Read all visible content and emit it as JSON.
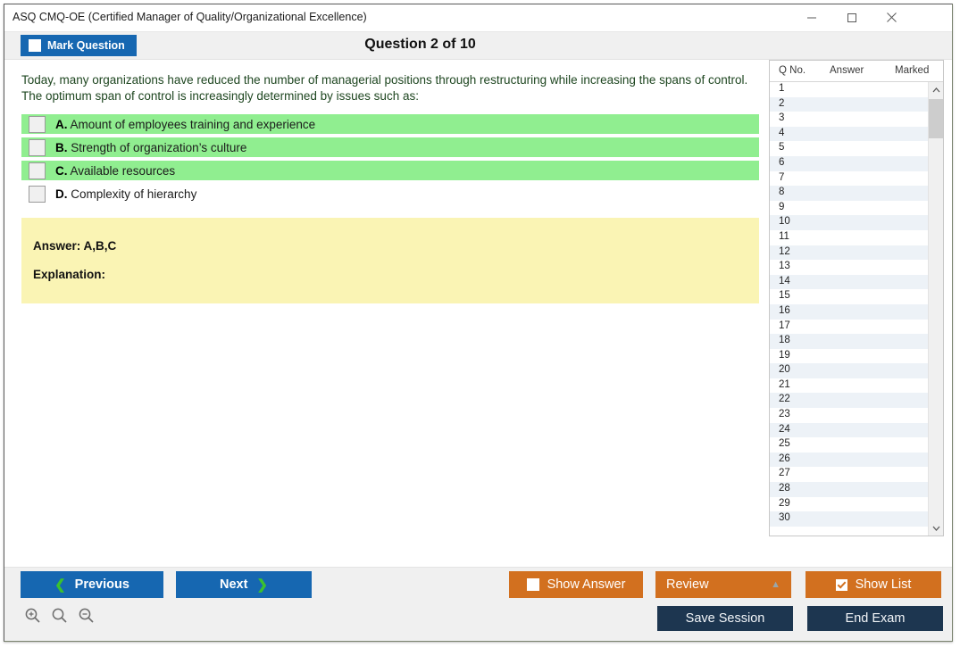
{
  "window": {
    "title": "ASQ CMQ-OE (Certified Manager of Quality/Organizational Excellence)",
    "minimize_icon": "minimize-icon",
    "maximize_icon": "maximize-icon",
    "close_icon": "close-icon"
  },
  "header": {
    "mark_question_label": "Mark Question",
    "mark_question_checked": false,
    "question_counter": "Question 2 of 10"
  },
  "question": {
    "stem": "Today, many organizations have reduced the number of managerial positions through restructuring while increasing the spans of control. The optimum span of control is increasingly determined by issues such as:",
    "options": [
      {
        "letter": "A.",
        "text": "Amount of employees training and experience",
        "correct": true,
        "checked": false
      },
      {
        "letter": "B.",
        "text": "Strength of organization’s culture",
        "correct": true,
        "checked": false
      },
      {
        "letter": "C.",
        "text": "Available resources",
        "correct": true,
        "checked": false
      },
      {
        "letter": "D.",
        "text": "Complexity of hierarchy",
        "correct": false,
        "checked": false
      }
    ],
    "answer_label": "Answer: A,B,C",
    "explanation_label": "Explanation:"
  },
  "question_list": {
    "columns": [
      "Q No.",
      "Answer",
      "Marked"
    ],
    "rows": [
      {
        "no": "1",
        "answer": "",
        "marked": ""
      },
      {
        "no": "2",
        "answer": "",
        "marked": ""
      },
      {
        "no": "3",
        "answer": "",
        "marked": ""
      },
      {
        "no": "4",
        "answer": "",
        "marked": ""
      },
      {
        "no": "5",
        "answer": "",
        "marked": ""
      },
      {
        "no": "6",
        "answer": "",
        "marked": ""
      },
      {
        "no": "7",
        "answer": "",
        "marked": ""
      },
      {
        "no": "8",
        "answer": "",
        "marked": ""
      },
      {
        "no": "9",
        "answer": "",
        "marked": ""
      },
      {
        "no": "10",
        "answer": "",
        "marked": ""
      },
      {
        "no": "11",
        "answer": "",
        "marked": ""
      },
      {
        "no": "12",
        "answer": "",
        "marked": ""
      },
      {
        "no": "13",
        "answer": "",
        "marked": ""
      },
      {
        "no": "14",
        "answer": "",
        "marked": ""
      },
      {
        "no": "15",
        "answer": "",
        "marked": ""
      },
      {
        "no": "16",
        "answer": "",
        "marked": ""
      },
      {
        "no": "17",
        "answer": "",
        "marked": ""
      },
      {
        "no": "18",
        "answer": "",
        "marked": ""
      },
      {
        "no": "19",
        "answer": "",
        "marked": ""
      },
      {
        "no": "20",
        "answer": "",
        "marked": ""
      },
      {
        "no": "21",
        "answer": "",
        "marked": ""
      },
      {
        "no": "22",
        "answer": "",
        "marked": ""
      },
      {
        "no": "23",
        "answer": "",
        "marked": ""
      },
      {
        "no": "24",
        "answer": "",
        "marked": ""
      },
      {
        "no": "25",
        "answer": "",
        "marked": ""
      },
      {
        "no": "26",
        "answer": "",
        "marked": ""
      },
      {
        "no": "27",
        "answer": "",
        "marked": ""
      },
      {
        "no": "28",
        "answer": "",
        "marked": ""
      },
      {
        "no": "29",
        "answer": "",
        "marked": ""
      },
      {
        "no": "30",
        "answer": "",
        "marked": ""
      }
    ]
  },
  "footer": {
    "previous_label": "Previous",
    "next_label": "Next",
    "show_answer_label": "Show Answer",
    "show_answer_checked": false,
    "review_label": "Review",
    "show_list_label": "Show List",
    "show_list_checked": true,
    "save_session_label": "Save Session",
    "end_exam_label": "End Exam",
    "zoom_in_icon": "zoom-in-icon",
    "zoom_reset_icon": "zoom-reset-icon",
    "zoom_out_icon": "zoom-out-icon"
  },
  "colors": {
    "accent_blue": "#1667b1",
    "accent_orange": "#d2701f",
    "navy": "#1d3650",
    "correct_green": "#90ee90",
    "answer_yellow": "#faf4b4",
    "chevron_green": "#3bc12e"
  }
}
